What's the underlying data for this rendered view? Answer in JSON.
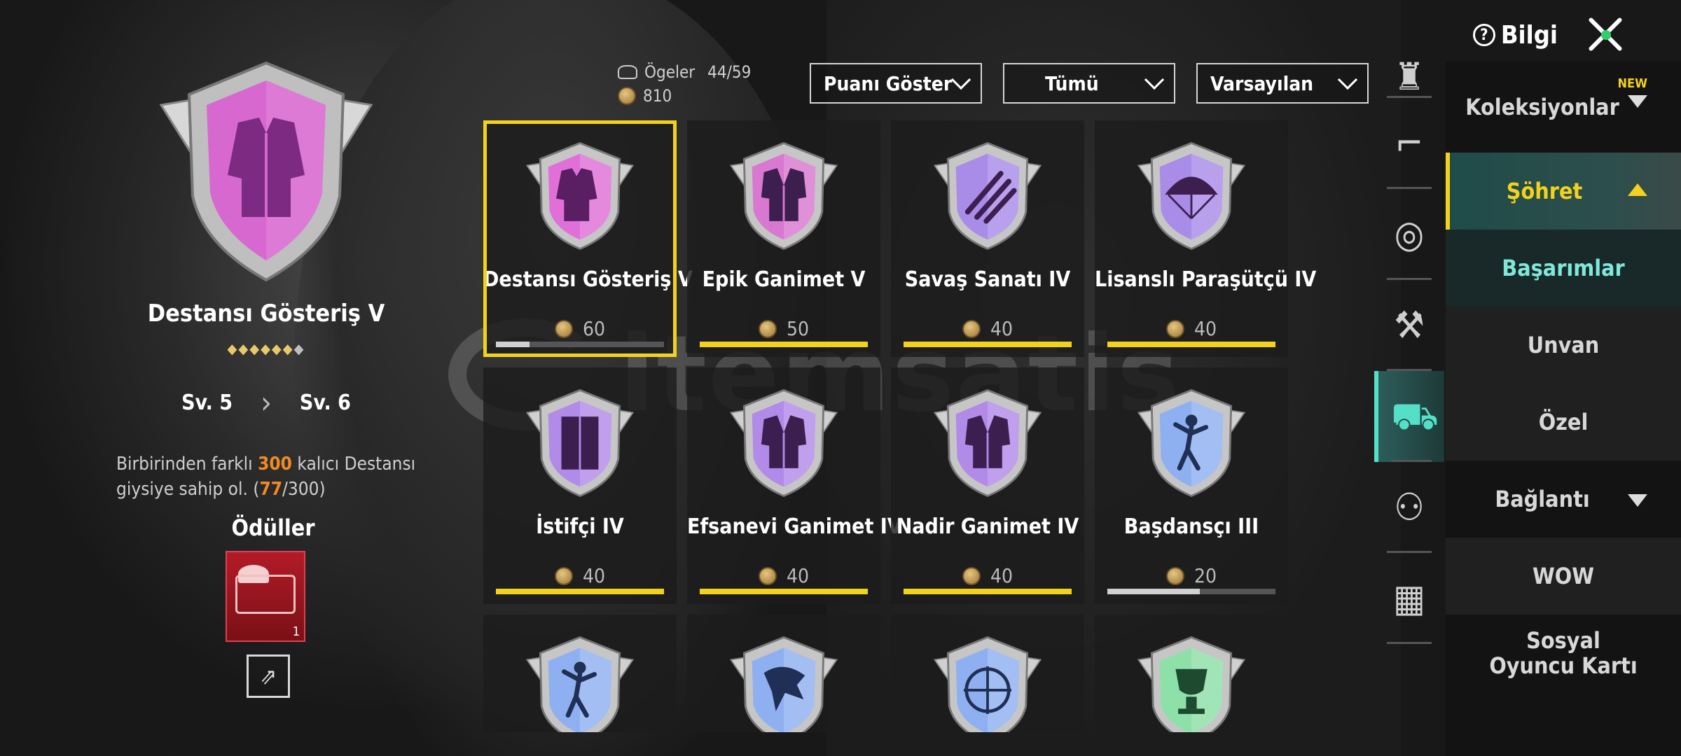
{
  "header": {
    "info_label": "Bilgi"
  },
  "detail": {
    "title": "Destansı Gösteriş V",
    "level_from": "Sv. 5",
    "level_to": "Sv. 6",
    "desc_pre": "Birbirinden farklı ",
    "desc_num": "300",
    "desc_mid": " kalıcı Destansı",
    "desc_line2_pre": "giysiye sahip ol. (",
    "desc_progress": "77",
    "desc_line2_post": "/300)",
    "rewards_title": "Ödüller",
    "reward_count": "1",
    "stars_filled": 6,
    "stars_total": 7
  },
  "stats": {
    "items_label": "Ögeler",
    "items_value": "44/59",
    "points": "810"
  },
  "filters": [
    {
      "label": "Puanı Göster"
    },
    {
      "label": "Tümü"
    },
    {
      "label": "Varsayılan"
    }
  ],
  "cards": [
    {
      "name": "Destansı Gösteriş V",
      "points": "60",
      "progress": 0.2,
      "color": "#e070d8",
      "icon": "jacket-icon",
      "selected": true
    },
    {
      "name": "Epik Ganimet V",
      "points": "50",
      "progress": 1,
      "color": "#d878d0",
      "icon": "robe-icon"
    },
    {
      "name": "Savaş Sanatı IV",
      "points": "40",
      "progress": 1,
      "color": "#a98be8",
      "icon": "claw-icon"
    },
    {
      "name": "Lisanslı Paraşütçü IV",
      "points": "40",
      "progress": 1,
      "color": "#a98be8",
      "icon": "parachute-icon"
    },
    {
      "name": "İstifçi IV",
      "points": "40",
      "progress": 1,
      "color": "#b28ae8",
      "icon": "wardrobe-icon"
    },
    {
      "name": "Efsanevi Ganimet IV",
      "points": "40",
      "progress": 1,
      "color": "#b28ae8",
      "icon": "robe-icon"
    },
    {
      "name": "Nadir Ganimet IV",
      "points": "40",
      "progress": 1,
      "color": "#b28ae8",
      "icon": "robe-icon"
    },
    {
      "name": "Başdansçı III",
      "points": "20",
      "progress": 0.55,
      "color": "#8fb0f0",
      "icon": "dancer-icon"
    },
    {
      "name": "",
      "points": "",
      "color": "#8fb0f0",
      "icon": "dancer-icon"
    },
    {
      "name": "",
      "points": "",
      "color": "#8fb0f0",
      "icon": "eagle-icon"
    },
    {
      "name": "",
      "points": "",
      "color": "#8fb0f0",
      "icon": "crosshair-icon"
    },
    {
      "name": "",
      "points": "",
      "color": "#8de0a8",
      "icon": "trophy-icon"
    }
  ],
  "iconbar": [
    {
      "icon": "crown-icon"
    },
    {
      "icon": "pistol-icon"
    },
    {
      "icon": "medal-icon"
    },
    {
      "icon": "muscle-icon"
    },
    {
      "icon": "vehicle-icon",
      "active": true
    },
    {
      "icon": "friends-icon"
    },
    {
      "icon": "grid-icon"
    }
  ],
  "nav": [
    {
      "label": "Koleksiyonlar",
      "badge": "NEW",
      "arrow": "down"
    },
    {
      "label": "Şöhret",
      "arrow": "up",
      "active": true
    },
    {
      "label": "Başarımlar",
      "style": "teal"
    },
    {
      "label": "Unvan",
      "style": "sub"
    },
    {
      "label": "Özel",
      "style": "sub"
    },
    {
      "label": "Bağlantı",
      "arrow": "down"
    },
    {
      "label": "WOW",
      "style": "sub"
    },
    {
      "label": "Sosyal Oyuncu Kartı"
    }
  ],
  "colors": {
    "accent": "#f3d21c",
    "bar_full": "#f3d21c",
    "bar_partial": "#d0d0d0",
    "highlight": "#f08a24"
  }
}
